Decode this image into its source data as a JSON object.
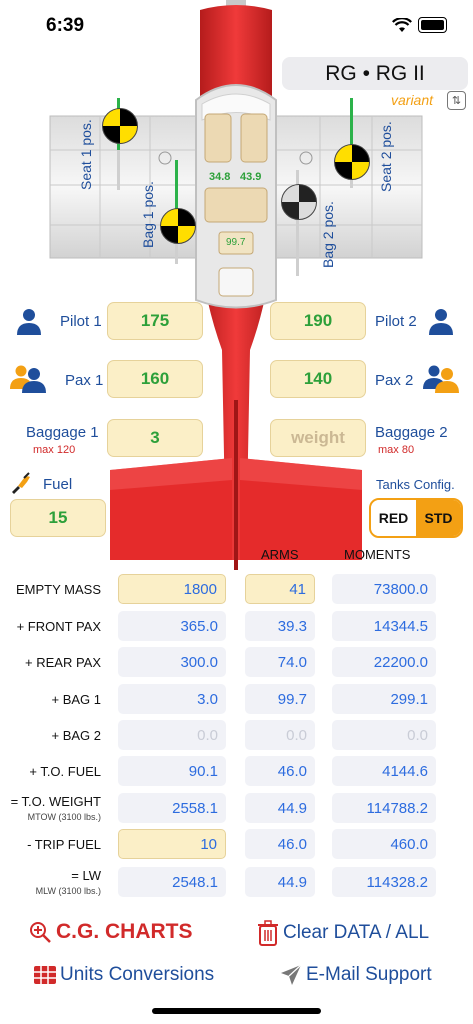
{
  "status": {
    "time": "6:39"
  },
  "variant": {
    "title": "RG • RG II",
    "label": "variant"
  },
  "diagram": {
    "seat1_label": "Seat 1 pos.",
    "seat2_label": "Seat 2 pos.",
    "bag1_label": "Bag 1 pos.",
    "bag2_label": "Bag 2 pos.",
    "arm_front": "34.8",
    "arm_rear": "43.9",
    "arm_bag": "99.7"
  },
  "loads": {
    "pilot1": {
      "label": "Pilot 1",
      "value": "175"
    },
    "pilot2": {
      "label": "Pilot 2",
      "value": "190"
    },
    "pax1": {
      "label": "Pax 1",
      "value": "160"
    },
    "pax2": {
      "label": "Pax 2",
      "value": "140"
    },
    "baggage1": {
      "label": "Baggage 1",
      "value": "3",
      "max": "max 120"
    },
    "baggage2": {
      "label": "Baggage 2",
      "placeholder": "weight",
      "max": "max 80"
    },
    "fuel": {
      "label": "Fuel",
      "value": "15"
    }
  },
  "tanks": {
    "label": "Tanks Config.",
    "options": [
      "RED",
      "STD"
    ],
    "selected": "STD"
  },
  "table": {
    "headers": {
      "arms": "ARMS",
      "moments": "MOMENTS"
    },
    "rows": [
      {
        "label": "EMPTY MASS",
        "sub": "",
        "mass": "1800",
        "arm": "41",
        "moment": "73800.0"
      },
      {
        "label": "+ FRONT PAX",
        "sub": "",
        "mass": "365.0",
        "arm": "39.3",
        "moment": "14344.5"
      },
      {
        "label": "+ REAR PAX",
        "sub": "",
        "mass": "300.0",
        "arm": "74.0",
        "moment": "22200.0"
      },
      {
        "label": "+ BAG 1",
        "sub": "",
        "mass": "3.0",
        "arm": "99.7",
        "moment": "299.1"
      },
      {
        "label": "+ BAG 2",
        "sub": "",
        "mass": "0.0",
        "arm": "0.0",
        "moment": "0.0"
      },
      {
        "label": "+ T.O. FUEL",
        "sub": "",
        "mass": "90.1",
        "arm": "46.0",
        "moment": "4144.6"
      },
      {
        "label": "= T.O. WEIGHT",
        "sub": "MTOW (3100 lbs.)",
        "mass": "2558.1",
        "arm": "44.9",
        "moment": "114788.2"
      },
      {
        "label": "- TRIP FUEL",
        "sub": "",
        "mass": "10",
        "arm": "46.0",
        "moment": "460.0"
      },
      {
        "label": "= LW",
        "sub": "MLW (3100 lbs.)",
        "mass": "2548.1",
        "arm": "44.9",
        "moment": "114328.2"
      }
    ]
  },
  "actions": {
    "cg_charts": "C.G. CHARTS",
    "clear": "Clear DATA / ALL",
    "units": "Units Conversions",
    "email": "E-Mail Support"
  },
  "colors": {
    "accent_blue": "#1f4e9b",
    "value_blue": "#2d6cdf",
    "plane_red": "#e52b2b",
    "input_bg": "#fbefc7",
    "green": "#2da03a",
    "orange": "#f3a014",
    "danger": "#d12a2a"
  }
}
